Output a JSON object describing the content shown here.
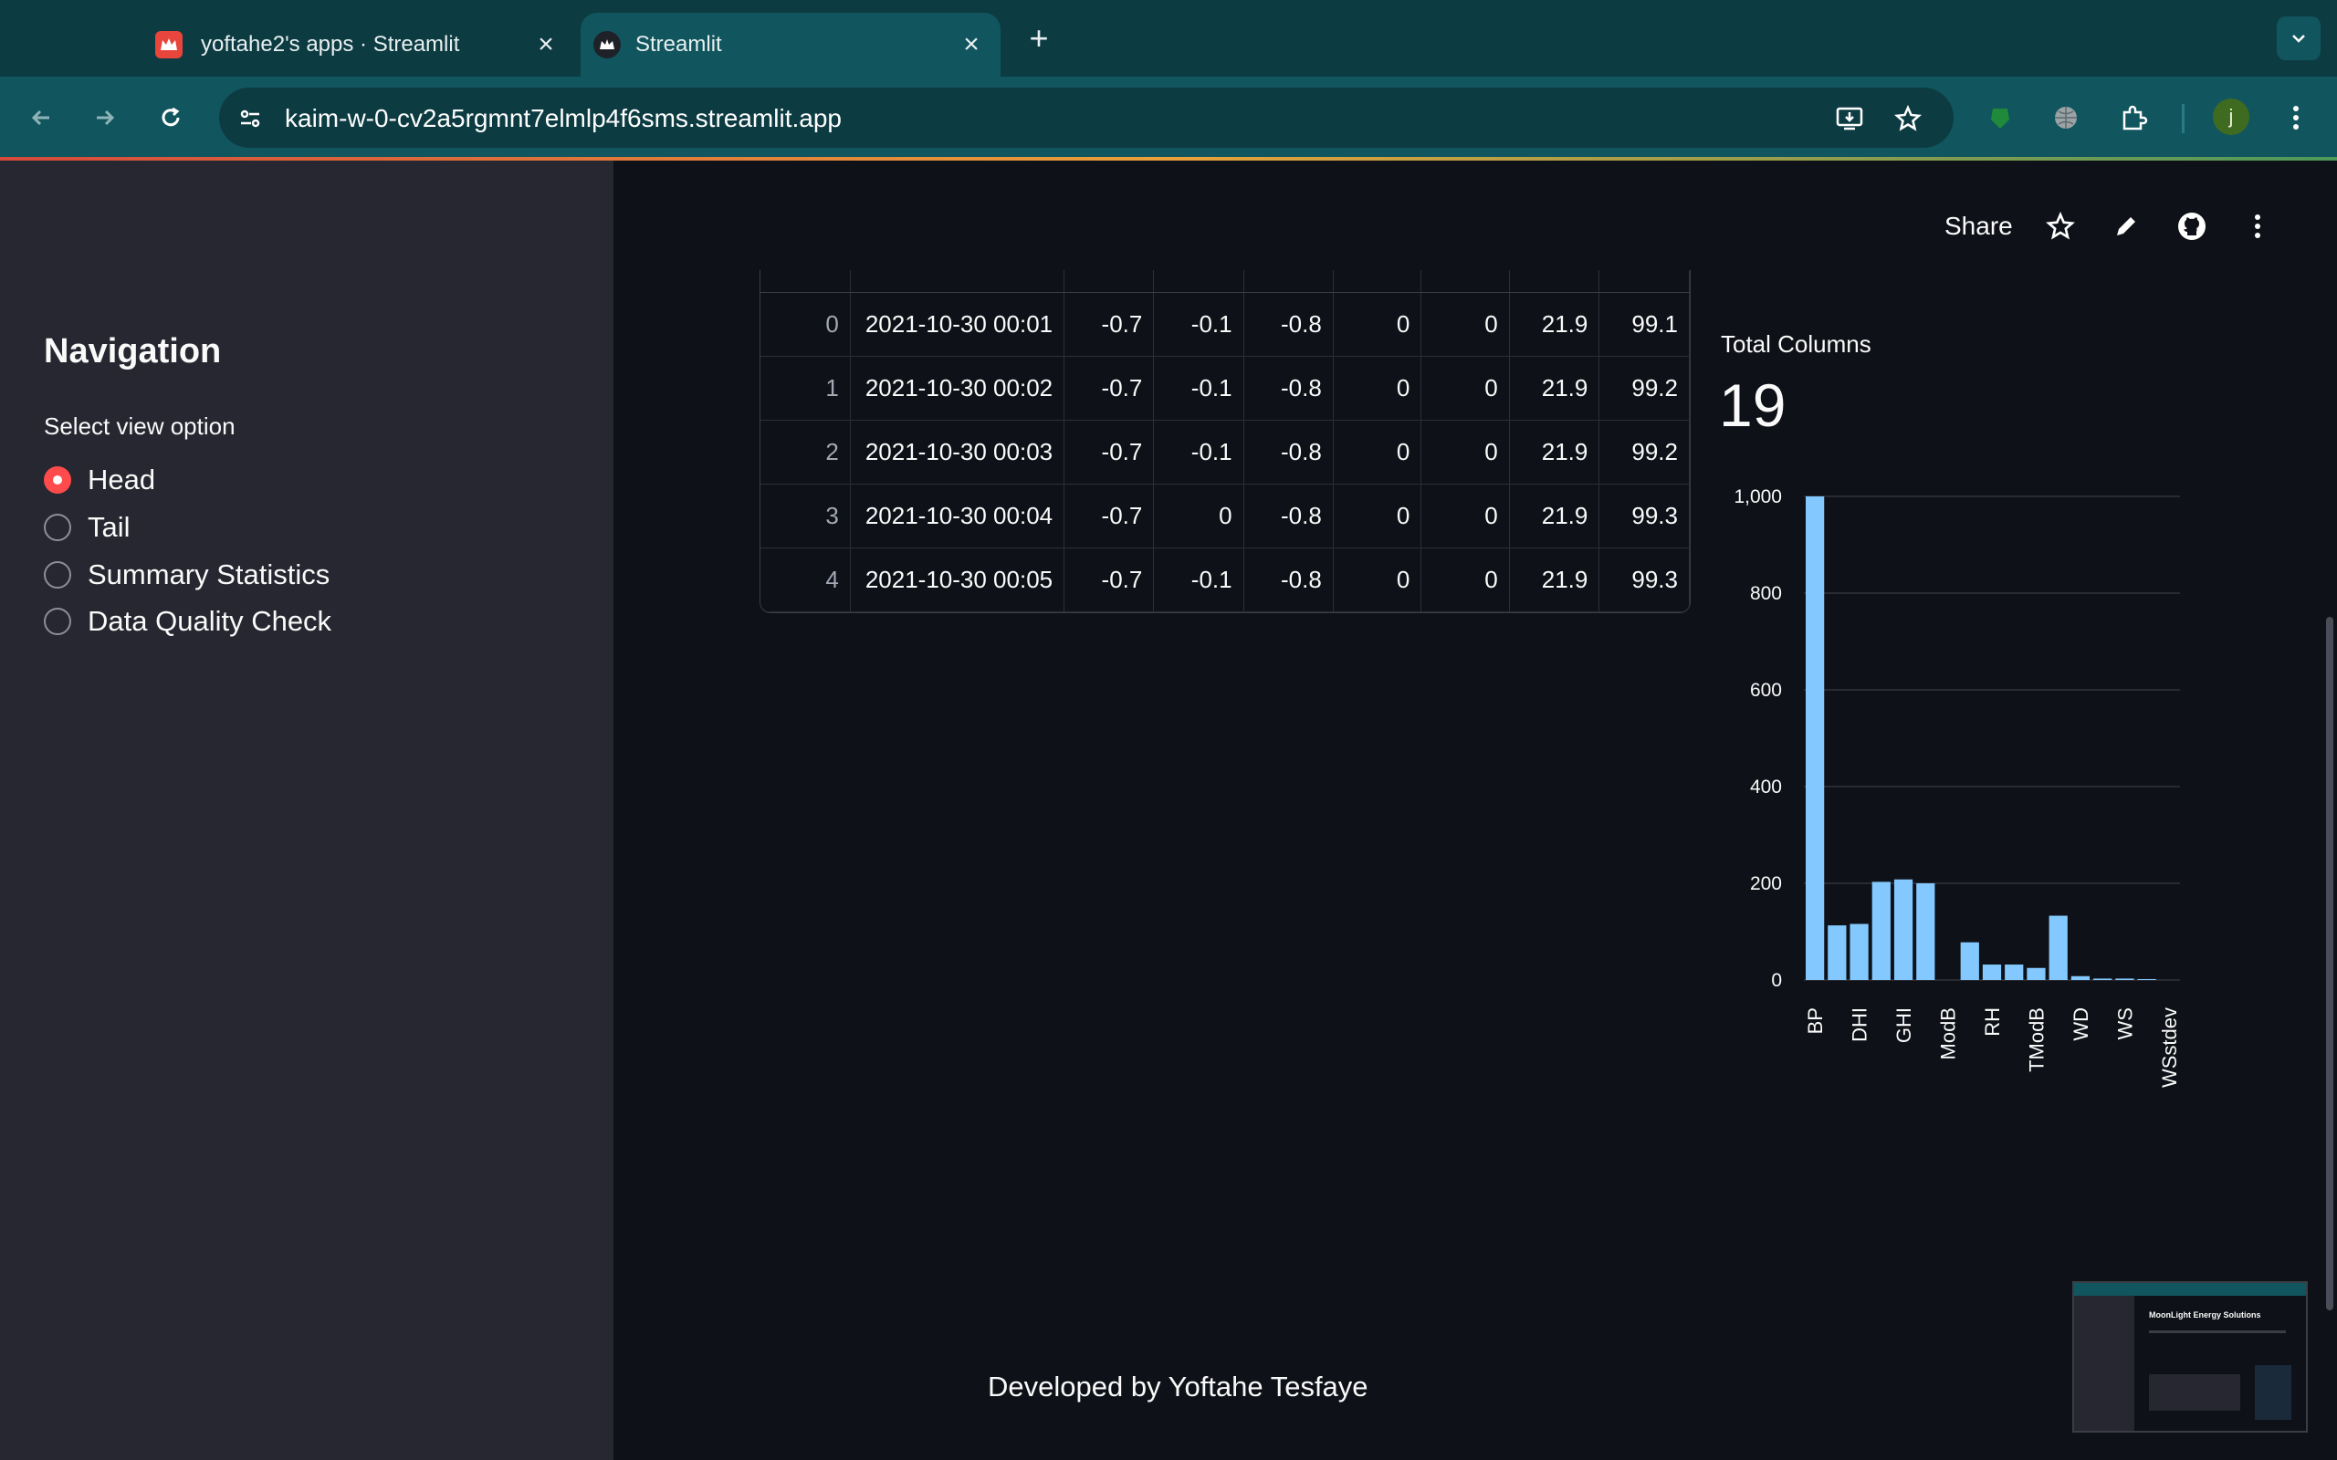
{
  "browser": {
    "tabs": [
      {
        "title": "yoftahe2's apps · Streamlit",
        "active": false
      },
      {
        "title": "Streamlit",
        "active": true
      }
    ],
    "url": "kaim-w-0-cv2a5rgmnt7elmlp4f6sms.streamlit.app",
    "profile_initial": "j",
    "new_tab_label": "+"
  },
  "header": {
    "share_label": "Share"
  },
  "sidebar": {
    "title": "Navigation",
    "radio_label": "Select view option",
    "options": [
      {
        "label": "Head",
        "selected": true
      },
      {
        "label": "Tail",
        "selected": false
      },
      {
        "label": "Summary Statistics",
        "selected": false
      },
      {
        "label": "Data Quality Check",
        "selected": false
      }
    ]
  },
  "table": {
    "rows": [
      {
        "index": "0",
        "timestamp": "2021-10-30 00:01",
        "values": [
          "-0.7",
          "-0.1",
          "-0.8",
          "0",
          "0",
          "21.9",
          "99.1"
        ]
      },
      {
        "index": "1",
        "timestamp": "2021-10-30 00:02",
        "values": [
          "-0.7",
          "-0.1",
          "-0.8",
          "0",
          "0",
          "21.9",
          "99.2"
        ]
      },
      {
        "index": "2",
        "timestamp": "2021-10-30 00:03",
        "values": [
          "-0.7",
          "-0.1",
          "-0.8",
          "0",
          "0",
          "21.9",
          "99.2"
        ]
      },
      {
        "index": "3",
        "timestamp": "2021-10-30 00:04",
        "values": [
          "-0.7",
          "0",
          "-0.8",
          "0",
          "0",
          "21.9",
          "99.3"
        ]
      },
      {
        "index": "4",
        "timestamp": "2021-10-30 00:05",
        "values": [
          "-0.7",
          "-0.1",
          "-0.8",
          "0",
          "0",
          "21.9",
          "99.3"
        ]
      }
    ]
  },
  "metric": {
    "label": "Total Columns",
    "value": "19"
  },
  "chart_data": {
    "type": "bar",
    "categories": [
      "BP",
      "",
      "DHI",
      "",
      "GHI",
      "",
      "ModB",
      "",
      "RH",
      "",
      "TModB",
      "",
      "WD",
      "",
      "WS",
      "",
      "WSstdev"
    ],
    "values": [
      1000,
      113,
      116,
      203,
      208,
      200,
      0,
      78,
      32,
      32,
      25,
      133,
      8,
      3,
      3,
      2,
      0
    ],
    "tick_labels": [
      "BP",
      "DHI",
      "GHI",
      "ModB",
      "RH",
      "TModB",
      "WD",
      "WS",
      "WSstdev"
    ],
    "y_ticks": [
      "0",
      "200",
      "400",
      "600",
      "800",
      "1,000"
    ],
    "ylim": [
      0,
      1000
    ],
    "bar_color": "#83c9ff",
    "grid": true
  },
  "footer": {
    "text": "Developed by Yoftahe Tesfaye"
  },
  "thumbnail": {
    "title": "MoonLight Energy Solutions"
  }
}
